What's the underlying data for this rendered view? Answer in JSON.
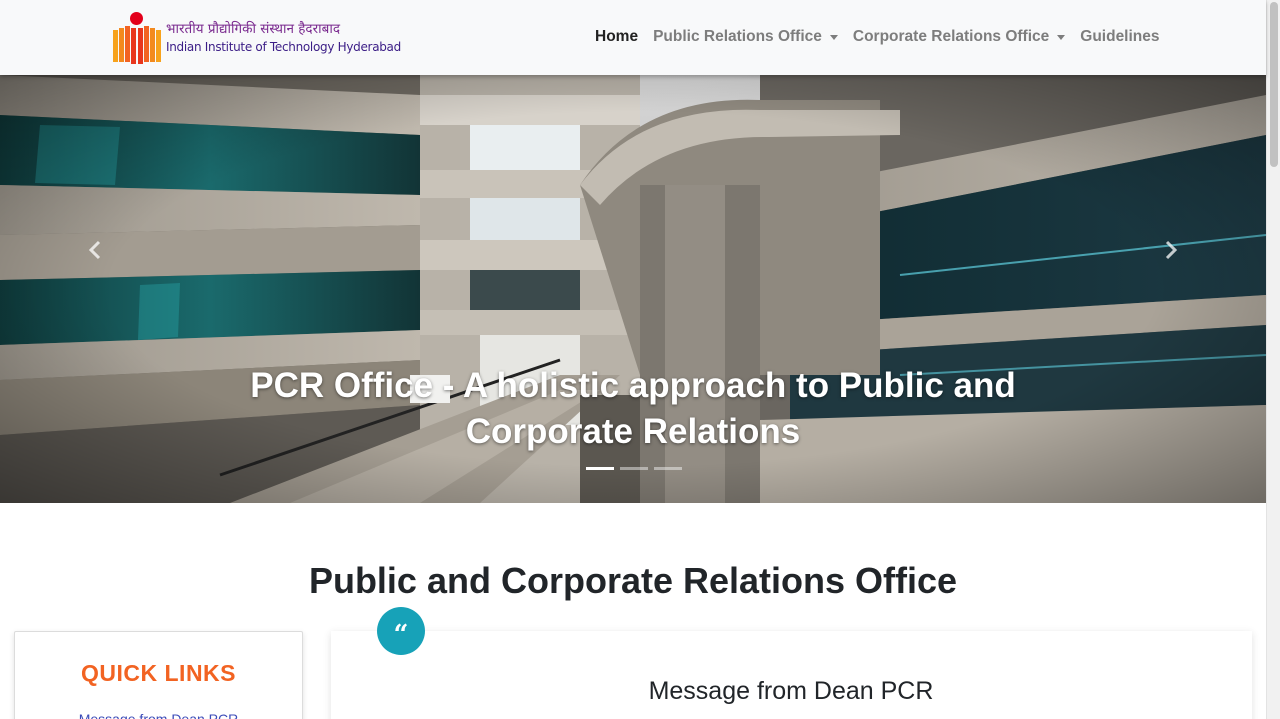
{
  "header": {
    "logo_hindi": "भारतीय प्रौद्योगिकी संस्थान हैदराबाद",
    "logo_english": "Indian Institute of Technology Hyderabad",
    "logo_icon": "iith-logo",
    "nav": [
      {
        "label": "Home",
        "active": true
      },
      {
        "label": "Public Relations Office",
        "dropdown": true
      },
      {
        "label": "Corporate Relations Office",
        "dropdown": true
      },
      {
        "label": "Guidelines"
      }
    ]
  },
  "hero": {
    "caption_line1": "PCR Office - A holistic approach to Public and",
    "caption_line2": "Corporate Relations",
    "prev_icon": "chevron-left-icon",
    "next_icon": "chevron-right-icon",
    "slides": 3,
    "active_slide": 1
  },
  "main": {
    "section_title": "Public and Corporate Relations Office",
    "quick_links": {
      "title": "QUICK LINKS",
      "first_link": "Message from Dean PCR"
    },
    "message": {
      "quote_icon": "quote-icon",
      "title": "Message from Dean PCR"
    }
  },
  "colors": {
    "accent_orange": "#f26322",
    "quote_teal": "#17a2b8",
    "link_blue": "#3b4bb8",
    "logo_red": "#e3001b"
  }
}
